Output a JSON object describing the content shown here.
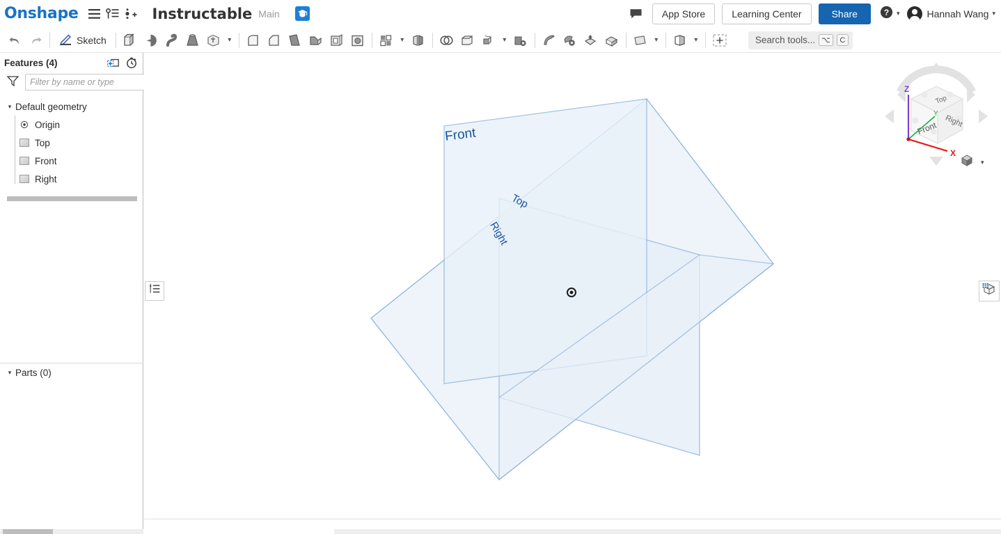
{
  "header": {
    "brand": "Onshape",
    "menu_icon": "hamburger-menu-icon",
    "versions_icon": "version-graph-icon",
    "branch_icon": "add-branch-icon",
    "doc_title": "Instructable",
    "branch_name": "Main",
    "edu_badge_icon": "graduation-cap-icon",
    "comments_icon": "comment-icon",
    "app_store_label": "App Store",
    "learning_center_label": "Learning Center",
    "share_label": "Share",
    "help_icon": "help-circle-icon",
    "user_name": "Hannah Wang",
    "avatar_icon": "user-avatar-icon",
    "caret": "▾"
  },
  "toolbar": {
    "undo_icon": "undo-arrow-icon",
    "redo_icon": "redo-arrow-icon",
    "sketch_label": "Sketch",
    "sketch_icon": "pencil-sketch-icon",
    "tools": [
      {
        "name": "extrude-icon"
      },
      {
        "name": "revolve-icon"
      },
      {
        "name": "sweep-icon"
      },
      {
        "name": "loft-icon"
      },
      {
        "name": "more-features-icon"
      }
    ],
    "modify_tools": [
      {
        "name": "fillet-icon"
      },
      {
        "name": "chamfer-icon"
      },
      {
        "name": "draft-icon"
      },
      {
        "name": "rib-icon"
      },
      {
        "name": "shell-icon"
      },
      {
        "name": "hole-icon"
      }
    ],
    "pattern_icon": "linear-pattern-icon",
    "mirror-icon": "mirror-icon",
    "boolean_icon": "boolean-icon",
    "split_icon": "split-icon",
    "transform_icon": "transform-icon",
    "delete_part_icon": "delete-part-icon",
    "move_face_icon": "move-face-icon",
    "delete_face_icon": "delete-face-icon",
    "replace_face_icon": "replace-face-icon",
    "enclose_icon": "enclose-icon",
    "plane_icon": "construction-plane-icon",
    "sheetmetal_icon": "sheet-metal-icon",
    "variable_icon": "add-variable-icon",
    "search": {
      "placeholder": "Search tools...",
      "shortcut_key_1": "⌥",
      "shortcut_key_2": "C"
    }
  },
  "left_panel": {
    "features_title": "Features (4)",
    "add_folder_icon": "add-folder-icon",
    "history_icon": "history-clock-icon",
    "filter_icon": "filter-funnel-icon",
    "filter_placeholder": "Filter by name or type",
    "filter_value": "",
    "tree": {
      "root_label": "Default geometry",
      "expanded": true,
      "children": [
        {
          "label": "Origin",
          "icon": "origin-point-icon"
        },
        {
          "label": "Top",
          "icon": "plane-icon"
        },
        {
          "label": "Front",
          "icon": "plane-icon"
        },
        {
          "label": "Right",
          "icon": "plane-icon"
        }
      ]
    },
    "parts_label": "Parts (0)",
    "parts_expanded": true
  },
  "viewport": {
    "plane_labels": [
      {
        "text": "Front"
      },
      {
        "text": "Top"
      },
      {
        "text": "Right"
      }
    ],
    "origin_marker": "origin-point-marker",
    "plane_fill": "#eaf1f8",
    "plane_stroke": "#8fb4dc",
    "label_color": "#18539e",
    "viewcube": {
      "axis_z_label": "Z",
      "axis_y_label": "Y",
      "axis_x_label": "X",
      "axis_z_color": "#7b3fd4",
      "axis_y_color": "#22b14c",
      "axis_x_color": "#ee1111",
      "face_top": "Top",
      "face_front": "Front",
      "face_right": "Right"
    },
    "display_style_icon": "display-style-cube-icon",
    "display_style_caret": "▾",
    "toggle_left_icon": "feature-list-panel-icon",
    "toggle_right_icon": "appearance-panel-icon"
  }
}
